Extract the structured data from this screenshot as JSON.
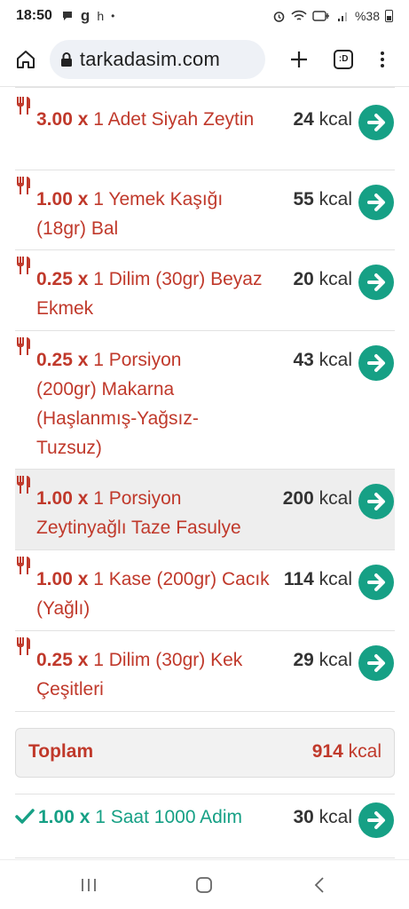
{
  "status": {
    "time": "18:50",
    "notif_letters": [
      "g",
      "h"
    ],
    "battery": "%38"
  },
  "browser": {
    "url": "tarkadasim.com",
    "tabs_label": ":D"
  },
  "colors": {
    "food": "#c0392b",
    "activity": "#16a085",
    "button": "#16a085"
  },
  "foods": [
    {
      "qty": "3.00 x",
      "desc": "1 Adet Siyah Zeytin",
      "kcal": "24",
      "unit": "kcal"
    },
    {
      "qty": "1.00 x",
      "desc": "1 Yemek Kaşığı (18gr) Bal",
      "kcal": "55",
      "unit": "kcal"
    },
    {
      "qty": "0.25 x",
      "desc": "1 Dilim (30gr) Beyaz Ekmek",
      "kcal": "20",
      "unit": "kcal"
    },
    {
      "qty": "0.25 x",
      "desc": "1 Porsiyon (200gr) Makarna (Haşlanmış-Yağsız-Tuzsuz)",
      "kcal": "43",
      "unit": "kcal"
    },
    {
      "qty": "1.00 x",
      "desc": "1 Porsiyon Zeytinyağlı Taze Fasulye",
      "kcal": "200",
      "unit": "kcal"
    },
    {
      "qty": "1.00 x",
      "desc": "1 Kase (200gr) Cacık (Yağlı)",
      "kcal": "114",
      "unit": "kcal"
    },
    {
      "qty": "0.25 x",
      "desc": "1 Dilim (30gr) Kek Çeşitleri",
      "kcal": "29",
      "unit": "kcal"
    }
  ],
  "total": {
    "label": "Toplam",
    "kcal": "914",
    "unit": "kcal"
  },
  "activity": {
    "qty": "1.00 x",
    "desc": "1 Saat 1000 Adim",
    "kcal": "30",
    "unit": "kcal"
  }
}
